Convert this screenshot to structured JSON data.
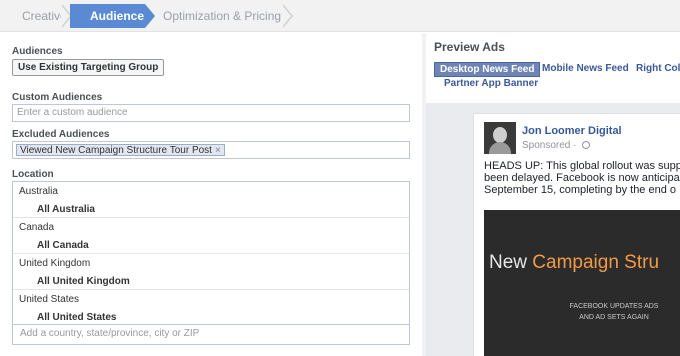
{
  "steps": {
    "creative": "Creative",
    "audience": "Audience",
    "optimization": "Optimization & Pricing"
  },
  "audiences": {
    "label": "Audiences",
    "button": "Use Existing Targeting Group",
    "custom_label": "Custom Audiences",
    "custom_placeholder": "Enter a custom audience",
    "excluded_label": "Excluded Audiences",
    "excluded_token": "Viewed New Campaign Structure Tour Post",
    "excluded_token_remove": "×"
  },
  "location": {
    "label": "Location",
    "rows": [
      {
        "country": "Australia",
        "scope": "All Australia"
      },
      {
        "country": "Canada",
        "scope": "All Canada"
      },
      {
        "country": "United Kingdom",
        "scope": "All United Kingdom"
      },
      {
        "country": "United States",
        "scope": "All United States"
      }
    ],
    "placeholder": "Add a country, state/province, city or ZIP"
  },
  "preview": {
    "title": "Preview Ads",
    "tabs": [
      "Desktop News Feed",
      "Mobile News Feed",
      "Right Colu",
      "Partner App Banner"
    ],
    "post": {
      "page_name": "Jon Loomer Digital",
      "sponsored": "Sponsored · ",
      "lines": [
        "HEADS UP: This global rollout was supp",
        "been delayed. Facebook is now anticipa",
        "September 15, completing by the end o"
      ],
      "image_title_a": "New ",
      "image_title_b": "Campaign Stru",
      "image_sub_1": "FACEBOOK UPDATES ADS",
      "image_sub_2": "AND AD SETS AGAIN"
    }
  }
}
